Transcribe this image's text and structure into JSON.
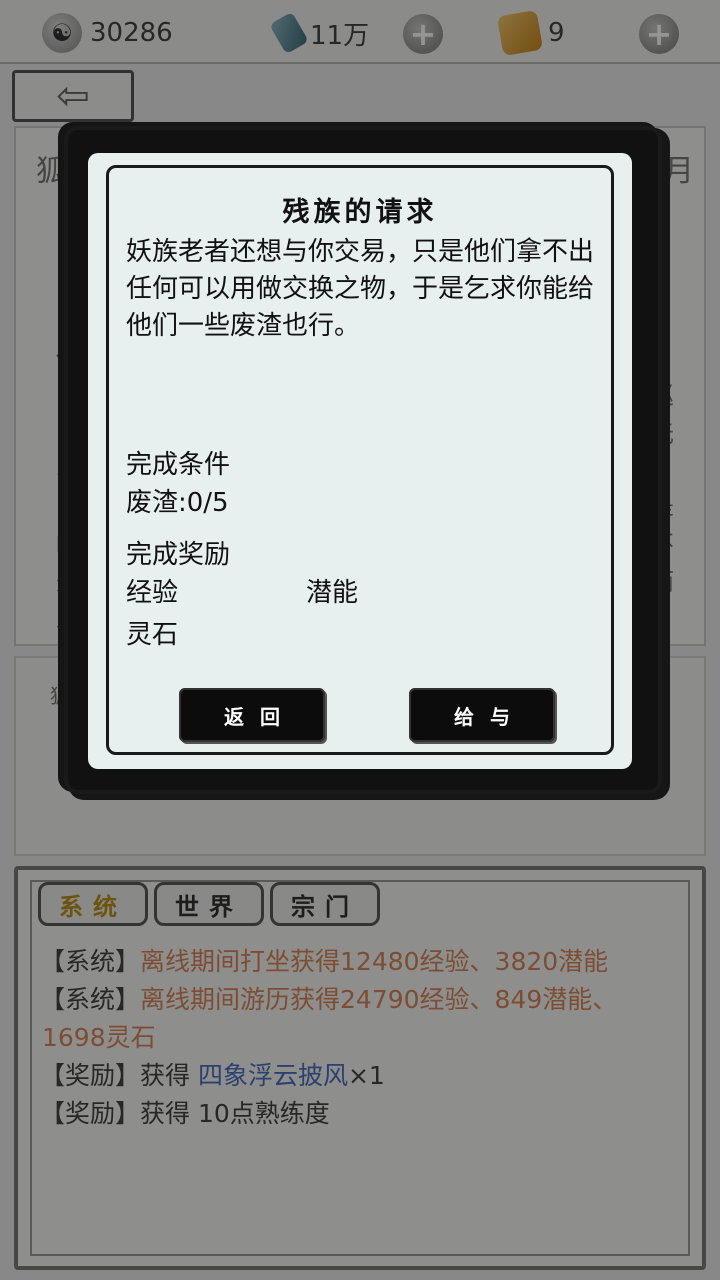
{
  "topbar": {
    "coins": "30286",
    "gems": "11万",
    "tokens": "9",
    "plus_symbol": "+"
  },
  "background": {
    "back_arrow": "⇦",
    "side_chars": [
      "狐",
      "月",
      "你",
      "巡",
      "由",
      "无",
      "收",
      "是",
      "吗",
      "不",
      "外",
      "而",
      "又"
    ],
    "panel2_label": "狐"
  },
  "chat": {
    "tabs": [
      "系统",
      "世界",
      "宗门"
    ],
    "lines": [
      {
        "tag": "【系统】",
        "text": "离线期间打坐获得12480经验、3820潜能"
      },
      {
        "tag": "【系统】",
        "text": "离线期间游历获得24790经验、849潜能、"
      },
      {
        "tag": "",
        "text": "1698灵石"
      },
      {
        "tag": "【奖励】",
        "prefix": "获得 ",
        "item": "四象浮云披风",
        "suffix": "×1"
      },
      {
        "tag": "【奖励】",
        "prefix": "获得 10点熟练度"
      }
    ]
  },
  "dialog": {
    "title": "残族的请求",
    "body": "妖族老者还想与你交易，只是他们拿不出任何可以用做交换之物，于是乞求你能给他们一些废渣也行。",
    "condition_label": "完成条件",
    "condition_value": "废渣:0/5",
    "reward_label": "完成奖励",
    "reward_exp": "经验",
    "reward_potential": "潜能",
    "reward_stone": "灵石",
    "button_back": "返回",
    "button_give": "给与"
  }
}
